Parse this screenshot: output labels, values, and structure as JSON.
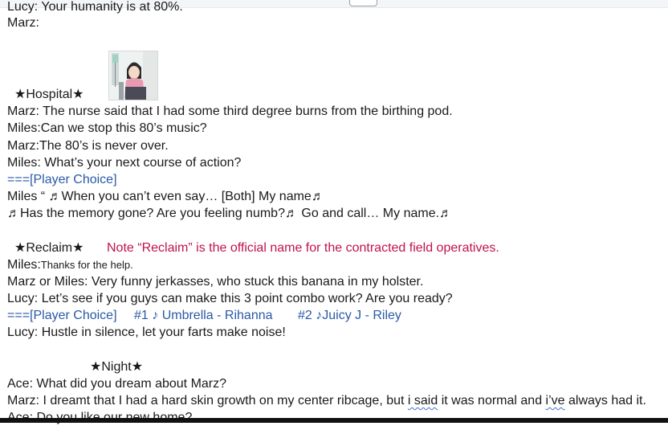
{
  "lines": {
    "l0": "Lucy: Your humanity is at 80%.",
    "l1": "Marz:",
    "hospital_header": "★Hospital★",
    "l2": "Marz: The nurse said that I had some third degree burns from the birthing pod.",
    "l3": "Miles:Can we stop this 80’s music?",
    "l4": "Marz:The 80’s is never over.",
    "l5": "Miles: What’s your next course of action?",
    "l6": "===[Player Choice]",
    "l7": "Miles “ ♬When you can’t even say… [Both] My name♬",
    "l8": "♬Has the memory gone? Are you feeling numb?♬ Go and call… My name.♬",
    "reclaim_header": "★Reclaim★",
    "reclaim_note": "Note “Reclaim” is the official name for the contracted field operatives.",
    "l9_prefix": "Miles:",
    "l9_small": "Thanks for the help.",
    "l10": "Marz or Miles: Very funny jerkasses, who stuck this banana in my holster.",
    "l11": "Lucy: Let’s see if you guys can make this 3 point combo work? Are you ready?",
    "l12_choice": "===[Player Choice]",
    "l12_opt1": "#1 ♪ Umbrella - Rihanna",
    "l12_opt2": "#2  ♪Juicy J - Riley",
    "l13": "Lucy: Hustle in silence, let your farts make noise!",
    "night_header": "★Night★",
    "l14": "Ace: What did you dream about Marz?",
    "l15_a": "Marz: I dreamt that I had a hard skin growth on my center ribcage, but ",
    "l15_b": "i said",
    "l15_c": " it was normal and ",
    "l15_d": "i’ve",
    "l15_e": " always had it.",
    "l16": "Ace: Do you like our new home?"
  },
  "colors": {
    "choice_blue": "#2a5aa6",
    "note_red": "#c0124e"
  }
}
